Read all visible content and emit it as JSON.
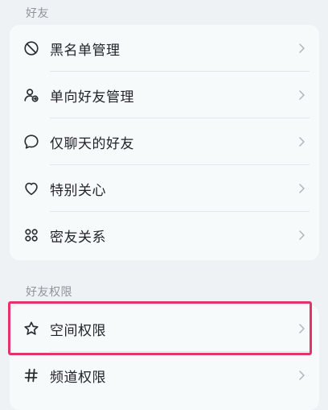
{
  "sections": [
    {
      "title": "好友",
      "items": [
        {
          "label": "黑名单管理",
          "icon": "block-icon"
        },
        {
          "label": "单向好友管理",
          "icon": "one-way-friend-icon"
        },
        {
          "label": "仅聊天的好友",
          "icon": "chat-bubble-icon"
        },
        {
          "label": "特别关心",
          "icon": "heart-icon"
        },
        {
          "label": "密友关系",
          "icon": "close-friends-icon"
        }
      ]
    },
    {
      "title": "好友权限",
      "items": [
        {
          "label": "空间权限",
          "icon": "star-icon"
        },
        {
          "label": "频道权限",
          "icon": "hashtag-icon"
        }
      ]
    }
  ],
  "colors": {
    "background": "#eef2f4",
    "card": "#f7fafb",
    "highlight": "#e2336b"
  }
}
